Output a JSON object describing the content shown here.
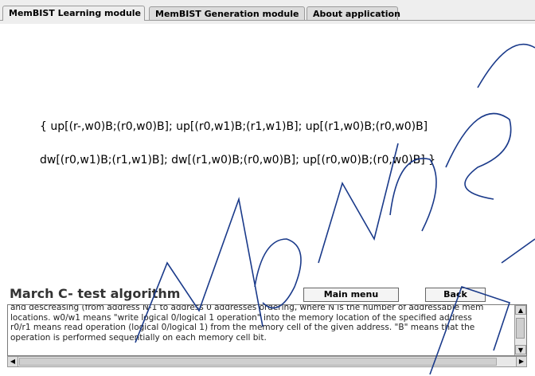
{
  "tabs": [
    {
      "label": "MemBIST Learning module"
    },
    {
      "label": "MemBIST Generation module"
    },
    {
      "label": "About application"
    }
  ],
  "algorithm": {
    "line1": "{ up[(r-,w0)B;(r0,w0)B]; up[(r0,w1)B;(r1,w1)B]; up[(r1,w0)B;(r0,w0)B]",
    "line2": "dw[(r0,w1)B;(r1,w1)B]; dw[(r1,w0)B;(r0,w0)B]; up[(r0,w0)B;(r0,w0)B] }"
  },
  "section_title": "March C- test algorithm",
  "buttons": {
    "main_menu": "Main menu",
    "back": "Back"
  },
  "description": [
    "and descreasing (from address N-1 to address 0 addresses ordering, where N is the number of addressable mem",
    "locations. w0/w1 means \"write logical 0/logical 1 operation\" into the memory location of the specified address",
    "r0/r1 means read operation (logical 0/logical 1) from the memory cell of the given address. \"B\" means that the",
    "operation is performed sequentially on each memory cell bit."
  ],
  "icons": {
    "scroll_up": "arrow-up-icon",
    "scroll_down": "arrow-down-icon",
    "scroll_left": "arrow-left-icon",
    "scroll_right": "arrow-right-icon"
  }
}
